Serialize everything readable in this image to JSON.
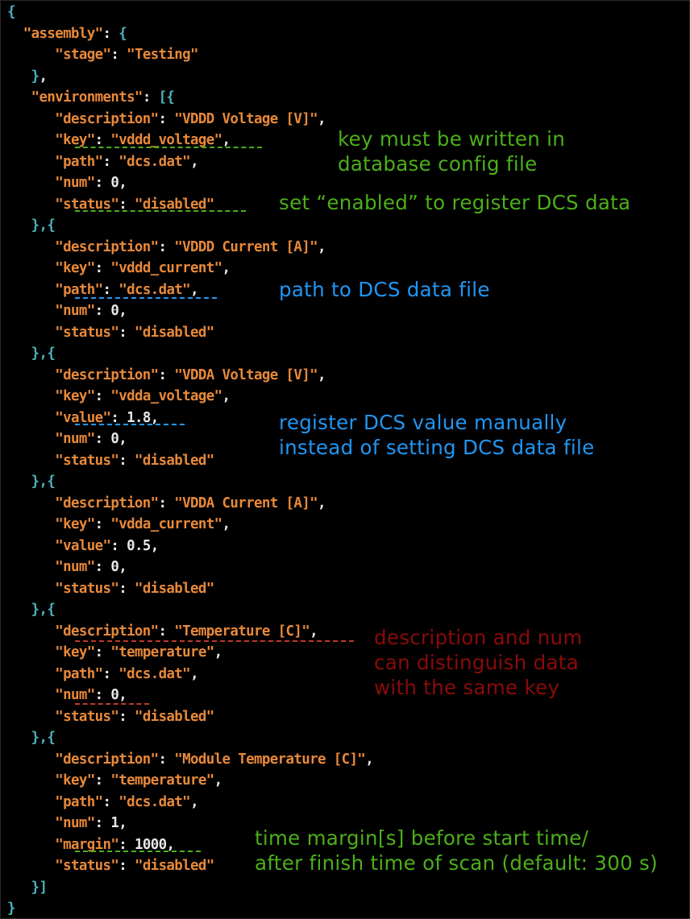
{
  "colors": {
    "background": "#000000",
    "brace": "#4fb3bf",
    "key": "#e8893a",
    "string": "#e8893a",
    "number": "#e8e8e8",
    "green_note": "#4caf1a",
    "blue_note": "#2196f3",
    "red_note": "#8b0a0a"
  },
  "code": {
    "lines": [
      [
        {
          "t": "{",
          "c": "brace"
        }
      ],
      [
        {
          "t": "  ",
          "c": "punc"
        },
        {
          "t": "\"assembly\"",
          "c": "key"
        },
        {
          "t": ": ",
          "c": "punc"
        },
        {
          "t": "{",
          "c": "brace"
        }
      ],
      [
        {
          "t": "      ",
          "c": "punc"
        },
        {
          "t": "\"stage\"",
          "c": "key"
        },
        {
          "t": ": ",
          "c": "punc"
        },
        {
          "t": "\"Testing\"",
          "c": "str"
        }
      ],
      [
        {
          "t": "   ",
          "c": "punc"
        },
        {
          "t": "}",
          "c": "brace"
        },
        {
          "t": ",",
          "c": "punc"
        }
      ],
      [
        {
          "t": "   ",
          "c": "punc"
        },
        {
          "t": "\"environments\"",
          "c": "key"
        },
        {
          "t": ": ",
          "c": "punc"
        },
        {
          "t": "[{",
          "c": "brace"
        }
      ],
      [
        {
          "t": "      ",
          "c": "punc"
        },
        {
          "t": "\"description\"",
          "c": "key"
        },
        {
          "t": ": ",
          "c": "punc"
        },
        {
          "t": "\"VDDD Voltage [V]\"",
          "c": "str"
        },
        {
          "t": ",",
          "c": "punc"
        }
      ],
      [
        {
          "t": "      ",
          "c": "punc"
        },
        {
          "t": "\"key\"",
          "c": "key"
        },
        {
          "t": ": ",
          "c": "punc"
        },
        {
          "t": "\"vddd_voltage\"",
          "c": "str"
        },
        {
          "t": ",",
          "c": "punc"
        }
      ],
      [
        {
          "t": "      ",
          "c": "punc"
        },
        {
          "t": "\"path\"",
          "c": "key"
        },
        {
          "t": ": ",
          "c": "punc"
        },
        {
          "t": "\"dcs.dat\"",
          "c": "str"
        },
        {
          "t": ",",
          "c": "punc"
        }
      ],
      [
        {
          "t": "      ",
          "c": "punc"
        },
        {
          "t": "\"num\"",
          "c": "key"
        },
        {
          "t": ": ",
          "c": "punc"
        },
        {
          "t": "0",
          "c": "num"
        },
        {
          "t": ",",
          "c": "punc"
        }
      ],
      [
        {
          "t": "      ",
          "c": "punc"
        },
        {
          "t": "\"status\"",
          "c": "key"
        },
        {
          "t": ": ",
          "c": "punc"
        },
        {
          "t": "\"disabled\"",
          "c": "str"
        }
      ],
      [
        {
          "t": "   ",
          "c": "punc"
        },
        {
          "t": "},{",
          "c": "brace"
        }
      ],
      [
        {
          "t": "      ",
          "c": "punc"
        },
        {
          "t": "\"description\"",
          "c": "key"
        },
        {
          "t": ": ",
          "c": "punc"
        },
        {
          "t": "\"VDDD Current [A]\"",
          "c": "str"
        },
        {
          "t": ",",
          "c": "punc"
        }
      ],
      [
        {
          "t": "      ",
          "c": "punc"
        },
        {
          "t": "\"key\"",
          "c": "key"
        },
        {
          "t": ": ",
          "c": "punc"
        },
        {
          "t": "\"vddd_current\"",
          "c": "str"
        },
        {
          "t": ",",
          "c": "punc"
        }
      ],
      [
        {
          "t": "      ",
          "c": "punc"
        },
        {
          "t": "\"path\"",
          "c": "key"
        },
        {
          "t": ": ",
          "c": "punc"
        },
        {
          "t": "\"dcs.dat\"",
          "c": "str"
        },
        {
          "t": ",",
          "c": "punc"
        }
      ],
      [
        {
          "t": "      ",
          "c": "punc"
        },
        {
          "t": "\"num\"",
          "c": "key"
        },
        {
          "t": ": ",
          "c": "punc"
        },
        {
          "t": "0",
          "c": "num"
        },
        {
          "t": ",",
          "c": "punc"
        }
      ],
      [
        {
          "t": "      ",
          "c": "punc"
        },
        {
          "t": "\"status\"",
          "c": "key"
        },
        {
          "t": ": ",
          "c": "punc"
        },
        {
          "t": "\"disabled\"",
          "c": "str"
        }
      ],
      [
        {
          "t": "   ",
          "c": "punc"
        },
        {
          "t": "},{",
          "c": "brace"
        }
      ],
      [
        {
          "t": "      ",
          "c": "punc"
        },
        {
          "t": "\"description\"",
          "c": "key"
        },
        {
          "t": ": ",
          "c": "punc"
        },
        {
          "t": "\"VDDA Voltage [V]\"",
          "c": "str"
        },
        {
          "t": ",",
          "c": "punc"
        }
      ],
      [
        {
          "t": "      ",
          "c": "punc"
        },
        {
          "t": "\"key\"",
          "c": "key"
        },
        {
          "t": ": ",
          "c": "punc"
        },
        {
          "t": "\"vdda_voltage\"",
          "c": "str"
        },
        {
          "t": ",",
          "c": "punc"
        }
      ],
      [
        {
          "t": "      ",
          "c": "punc"
        },
        {
          "t": "\"value\"",
          "c": "key"
        },
        {
          "t": ": ",
          "c": "punc"
        },
        {
          "t": "1.8",
          "c": "num"
        },
        {
          "t": ",",
          "c": "punc"
        }
      ],
      [
        {
          "t": "      ",
          "c": "punc"
        },
        {
          "t": "\"num\"",
          "c": "key"
        },
        {
          "t": ": ",
          "c": "punc"
        },
        {
          "t": "0",
          "c": "num"
        },
        {
          "t": ",",
          "c": "punc"
        }
      ],
      [
        {
          "t": "      ",
          "c": "punc"
        },
        {
          "t": "\"status\"",
          "c": "key"
        },
        {
          "t": ": ",
          "c": "punc"
        },
        {
          "t": "\"disabled\"",
          "c": "str"
        }
      ],
      [
        {
          "t": "   ",
          "c": "punc"
        },
        {
          "t": "},{",
          "c": "brace"
        }
      ],
      [
        {
          "t": "      ",
          "c": "punc"
        },
        {
          "t": "\"description\"",
          "c": "key"
        },
        {
          "t": ": ",
          "c": "punc"
        },
        {
          "t": "\"VDDA Current [A]\"",
          "c": "str"
        },
        {
          "t": ",",
          "c": "punc"
        }
      ],
      [
        {
          "t": "      ",
          "c": "punc"
        },
        {
          "t": "\"key\"",
          "c": "key"
        },
        {
          "t": ": ",
          "c": "punc"
        },
        {
          "t": "\"vdda_current\"",
          "c": "str"
        },
        {
          "t": ",",
          "c": "punc"
        }
      ],
      [
        {
          "t": "      ",
          "c": "punc"
        },
        {
          "t": "\"value\"",
          "c": "key"
        },
        {
          "t": ": ",
          "c": "punc"
        },
        {
          "t": "0.5",
          "c": "num"
        },
        {
          "t": ",",
          "c": "punc"
        }
      ],
      [
        {
          "t": "      ",
          "c": "punc"
        },
        {
          "t": "\"num\"",
          "c": "key"
        },
        {
          "t": ": ",
          "c": "punc"
        },
        {
          "t": "0",
          "c": "num"
        },
        {
          "t": ",",
          "c": "punc"
        }
      ],
      [
        {
          "t": "      ",
          "c": "punc"
        },
        {
          "t": "\"status\"",
          "c": "key"
        },
        {
          "t": ": ",
          "c": "punc"
        },
        {
          "t": "\"disabled\"",
          "c": "str"
        }
      ],
      [
        {
          "t": "   ",
          "c": "punc"
        },
        {
          "t": "},{",
          "c": "brace"
        }
      ],
      [
        {
          "t": "      ",
          "c": "punc"
        },
        {
          "t": "\"description\"",
          "c": "key"
        },
        {
          "t": ": ",
          "c": "punc"
        },
        {
          "t": "\"Temperature [C]\"",
          "c": "str"
        },
        {
          "t": ",",
          "c": "punc"
        }
      ],
      [
        {
          "t": "      ",
          "c": "punc"
        },
        {
          "t": "\"key\"",
          "c": "key"
        },
        {
          "t": ": ",
          "c": "punc"
        },
        {
          "t": "\"temperature\"",
          "c": "str"
        },
        {
          "t": ",",
          "c": "punc"
        }
      ],
      [
        {
          "t": "      ",
          "c": "punc"
        },
        {
          "t": "\"path\"",
          "c": "key"
        },
        {
          "t": ": ",
          "c": "punc"
        },
        {
          "t": "\"dcs.dat\"",
          "c": "str"
        },
        {
          "t": ",",
          "c": "punc"
        }
      ],
      [
        {
          "t": "      ",
          "c": "punc"
        },
        {
          "t": "\"num\"",
          "c": "key"
        },
        {
          "t": ": ",
          "c": "punc"
        },
        {
          "t": "0",
          "c": "num"
        },
        {
          "t": ",",
          "c": "punc"
        }
      ],
      [
        {
          "t": "      ",
          "c": "punc"
        },
        {
          "t": "\"status\"",
          "c": "key"
        },
        {
          "t": ": ",
          "c": "punc"
        },
        {
          "t": "\"disabled\"",
          "c": "str"
        }
      ],
      [
        {
          "t": "   ",
          "c": "punc"
        },
        {
          "t": "},{",
          "c": "brace"
        }
      ],
      [
        {
          "t": "      ",
          "c": "punc"
        },
        {
          "t": "\"description\"",
          "c": "key"
        },
        {
          "t": ": ",
          "c": "punc"
        },
        {
          "t": "\"Module Temperature [C]\"",
          "c": "str"
        },
        {
          "t": ",",
          "c": "punc"
        }
      ],
      [
        {
          "t": "      ",
          "c": "punc"
        },
        {
          "t": "\"key\"",
          "c": "key"
        },
        {
          "t": ": ",
          "c": "punc"
        },
        {
          "t": "\"temperature\"",
          "c": "str"
        },
        {
          "t": ",",
          "c": "punc"
        }
      ],
      [
        {
          "t": "      ",
          "c": "punc"
        },
        {
          "t": "\"path\"",
          "c": "key"
        },
        {
          "t": ": ",
          "c": "punc"
        },
        {
          "t": "\"dcs.dat\"",
          "c": "str"
        },
        {
          "t": ",",
          "c": "punc"
        }
      ],
      [
        {
          "t": "      ",
          "c": "punc"
        },
        {
          "t": "\"num\"",
          "c": "key"
        },
        {
          "t": ": ",
          "c": "punc"
        },
        {
          "t": "1",
          "c": "num"
        },
        {
          "t": ",",
          "c": "punc"
        }
      ],
      [
        {
          "t": "      ",
          "c": "punc"
        },
        {
          "t": "\"margin\"",
          "c": "key"
        },
        {
          "t": ": ",
          "c": "punc"
        },
        {
          "t": "1000",
          "c": "num"
        },
        {
          "t": ",",
          "c": "punc"
        }
      ],
      [
        {
          "t": "      ",
          "c": "punc"
        },
        {
          "t": "\"status\"",
          "c": "key"
        },
        {
          "t": ": ",
          "c": "punc"
        },
        {
          "t": "\"disabled\"",
          "c": "str"
        }
      ],
      [
        {
          "t": "   ",
          "c": "punc"
        },
        {
          "t": "}]",
          "c": "brace"
        }
      ],
      [
        {
          "t": "}",
          "c": "brace"
        }
      ]
    ]
  },
  "annotations": {
    "key_note": "key must be written in\ndatabase config file",
    "status_note": "set “enabled” to register DCS data",
    "path_note": "path to DCS data file",
    "value_note": "register DCS value manually\ninstead of setting DCS data file",
    "num_note": "description and num\ncan distinguish data\nwith the same key",
    "margin_note": "time margin[s] before start time/\nafter finish time of scan (default: 300 s)"
  }
}
